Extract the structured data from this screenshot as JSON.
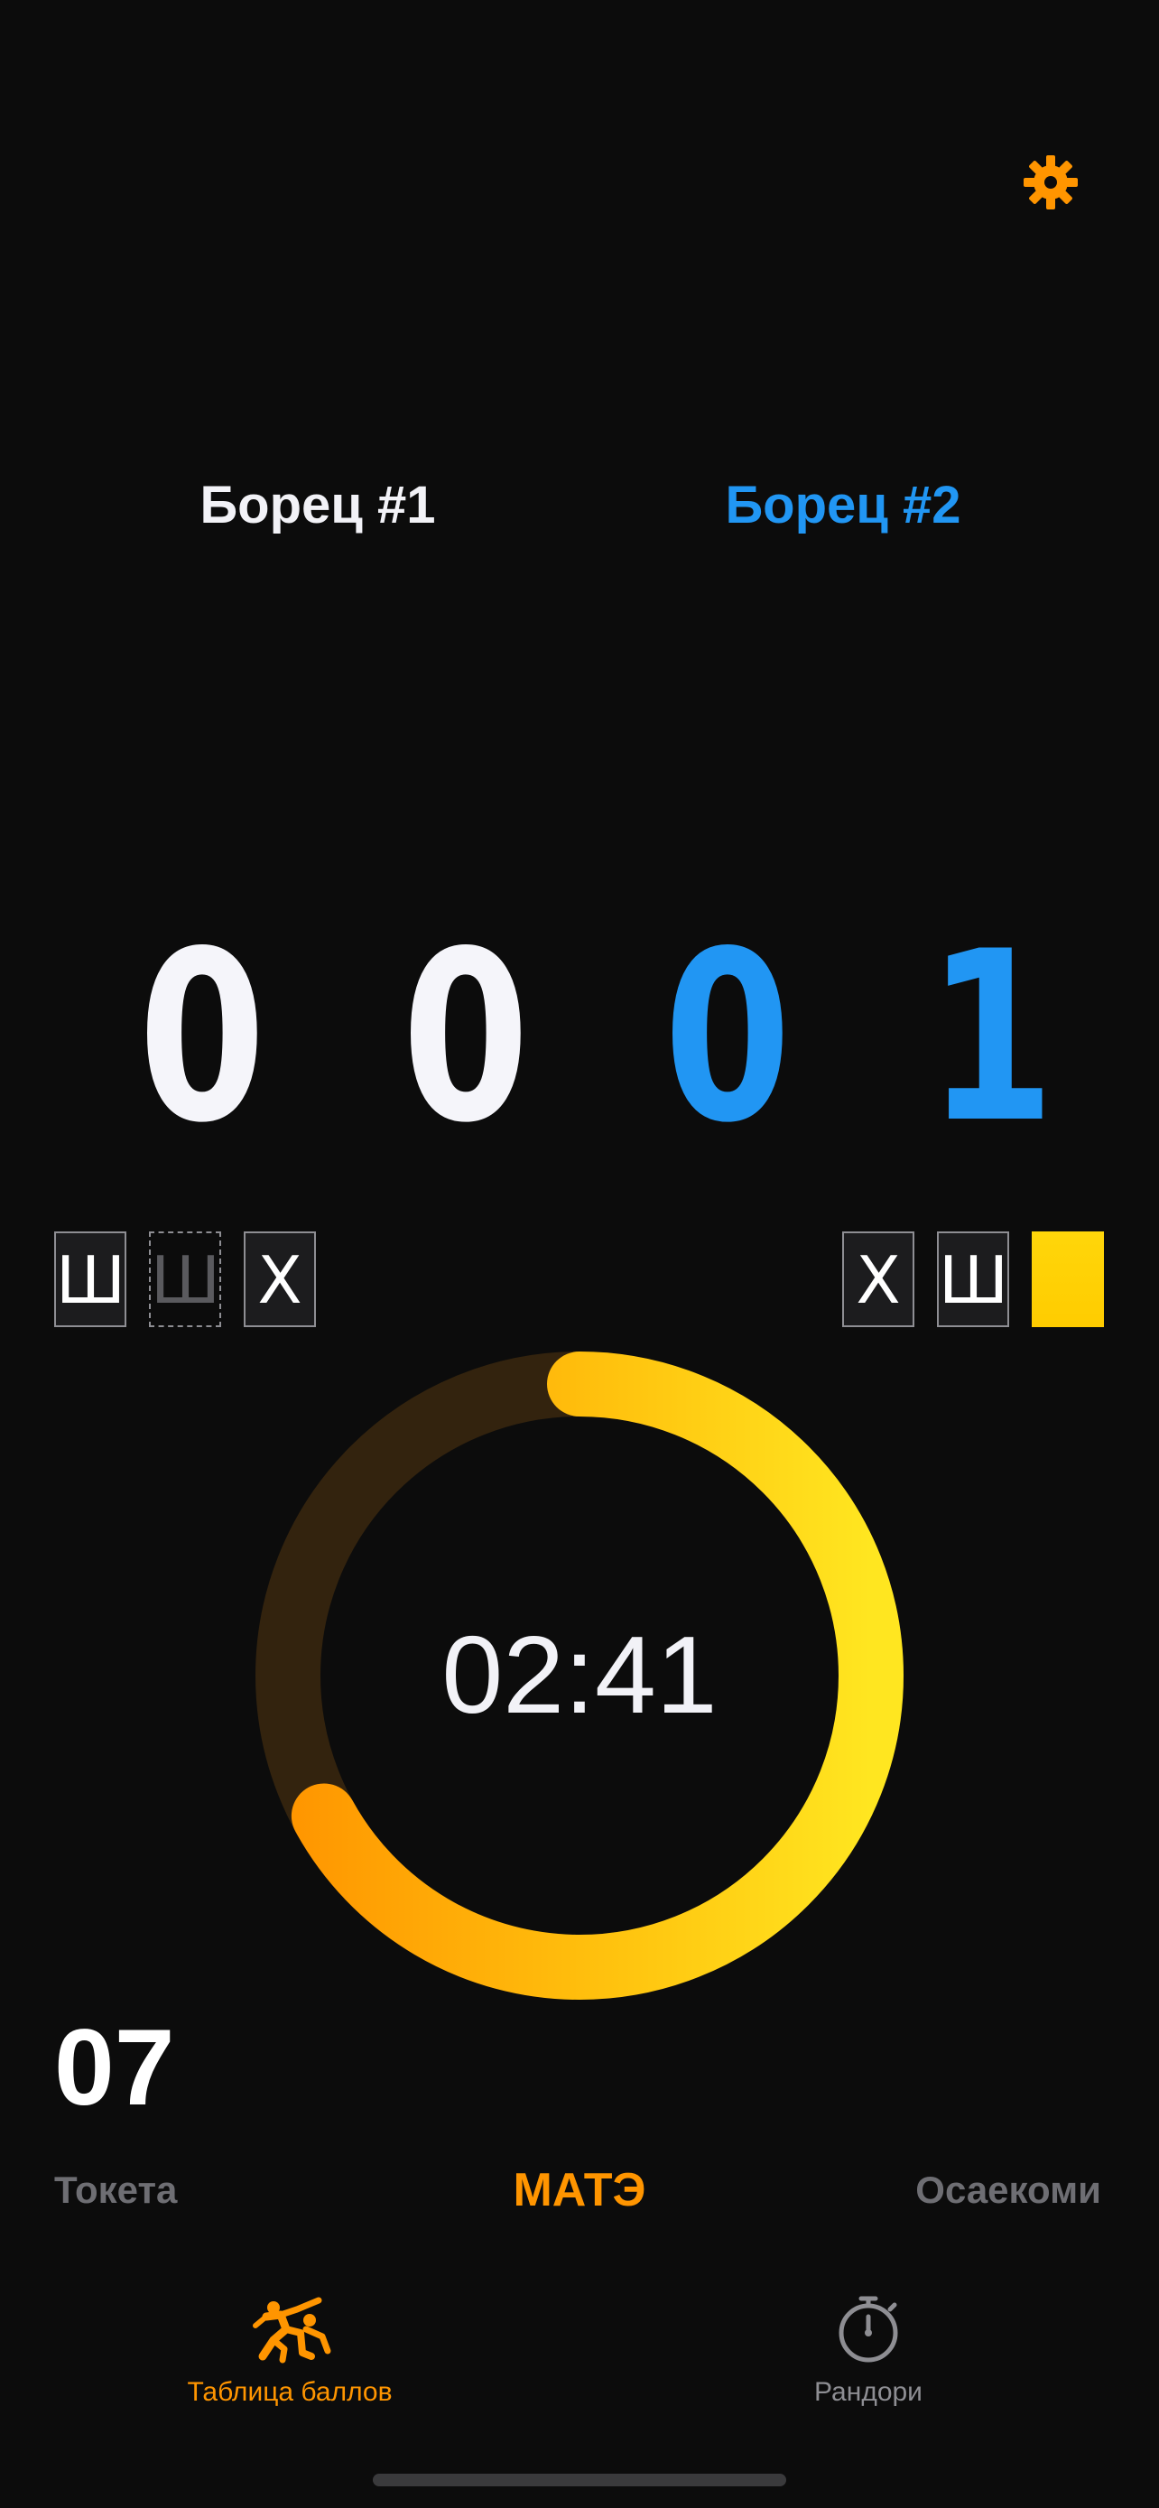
{
  "header": {
    "settings_icon": "gear-icon",
    "accent_color": "#ff9500"
  },
  "fighters": {
    "fighter1_name": "Борец #1",
    "fighter2_name": "Борец #2",
    "fighter1_color": "#f2f2f7",
    "fighter2_color": "#2196f3"
  },
  "scores": {
    "fighter1_digit1": "0",
    "fighter1_digit2": "0",
    "fighter2_digit1": "0",
    "fighter2_digit2": "1"
  },
  "penalties": {
    "fighter1": [
      "Ш",
      "Ш",
      "Х"
    ],
    "fighter2": [
      "Х",
      "Ш"
    ],
    "fighter2_card_color": "#ffd60a"
  },
  "timer": {
    "display": "02:41",
    "remaining_fraction": 0.67
  },
  "osaekomi_counter": "07",
  "actions": {
    "toketa": "Токета",
    "mate": "МАТЭ",
    "osaekomi": "Осаекоми"
  },
  "tabs": [
    {
      "label": "Таблица баллов",
      "icon": "wrestlers-icon",
      "active": true
    },
    {
      "label": "Рандори",
      "icon": "stopwatch-icon",
      "active": false
    }
  ]
}
